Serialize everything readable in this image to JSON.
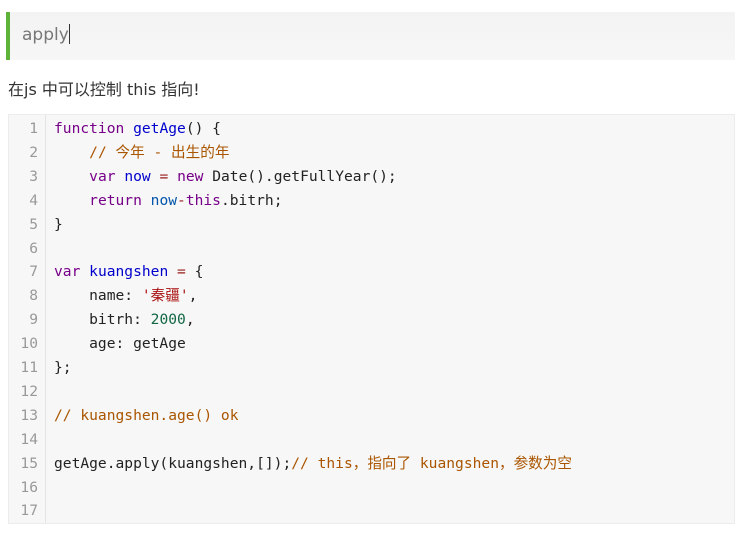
{
  "heading": {
    "text": "apply"
  },
  "paragraph": "在js 中可以控制 this 指向!",
  "code": {
    "lines": [
      [
        [
          "keyword",
          "function"
        ],
        [
          "plain",
          " "
        ],
        [
          "def",
          "getAge"
        ],
        [
          "plain",
          "() {"
        ]
      ],
      [
        [
          "plain",
          "    "
        ],
        [
          "comment",
          "// 今年 - 出生的年"
        ]
      ],
      [
        [
          "plain",
          "    "
        ],
        [
          "keyword",
          "var"
        ],
        [
          "plain",
          " "
        ],
        [
          "def",
          "now"
        ],
        [
          "plain",
          " "
        ],
        [
          "operator",
          "="
        ],
        [
          "plain",
          " "
        ],
        [
          "keyword",
          "new"
        ],
        [
          "plain",
          " Date().getFullYear();"
        ]
      ],
      [
        [
          "plain",
          "    "
        ],
        [
          "keyword",
          "return"
        ],
        [
          "plain",
          " "
        ],
        [
          "variable",
          "now"
        ],
        [
          "operator",
          "-"
        ],
        [
          "keyword",
          "this"
        ],
        [
          "plain",
          ".bitrh;"
        ]
      ],
      [
        [
          "plain",
          "}"
        ]
      ],
      [],
      [
        [
          "keyword",
          "var"
        ],
        [
          "plain",
          " "
        ],
        [
          "def",
          "kuangshen"
        ],
        [
          "plain",
          " "
        ],
        [
          "operator",
          "="
        ],
        [
          "plain",
          " {"
        ]
      ],
      [
        [
          "plain",
          "    name: "
        ],
        [
          "string",
          "'秦疆'"
        ],
        [
          "plain",
          ","
        ]
      ],
      [
        [
          "plain",
          "    bitrh: "
        ],
        [
          "number",
          "2000"
        ],
        [
          "plain",
          ","
        ]
      ],
      [
        [
          "plain",
          "    age: getAge"
        ]
      ],
      [
        [
          "plain",
          "};"
        ]
      ],
      [],
      [
        [
          "comment",
          "// kuangshen.age() ok"
        ]
      ],
      [],
      [
        [
          "plain",
          "getAge.apply(kuangshen,[]);"
        ],
        [
          "comment",
          "// this，指向了 kuangshen，参数为空"
        ]
      ],
      [],
      []
    ]
  }
}
